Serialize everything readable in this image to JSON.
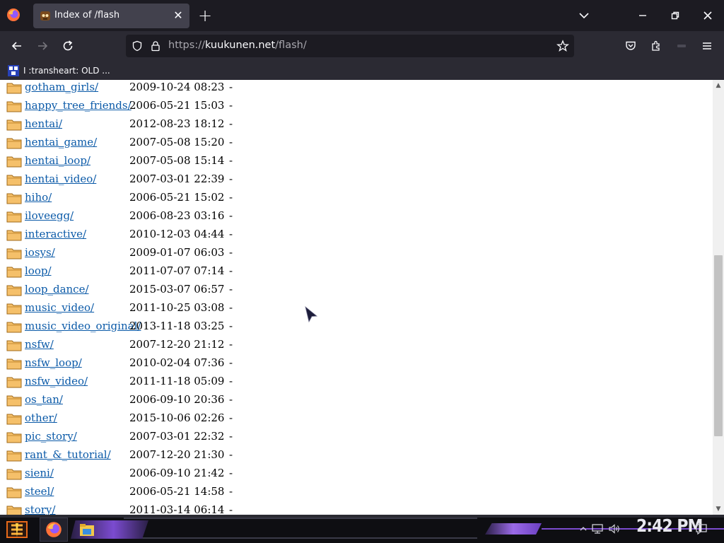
{
  "browser": {
    "tab_title": "Index of /flash",
    "url_prefix": "https://",
    "url_domain": "kuukunen.net",
    "url_path": "/flash/",
    "bookmark_label": "I :transheart: OLD ..."
  },
  "listing": {
    "entries": [
      {
        "name": "gotham_girls/",
        "date": "2009-10-24 08:23",
        "size": "-"
      },
      {
        "name": "happy_tree_friends/",
        "date": "2006-05-21 15:03",
        "size": "-"
      },
      {
        "name": "hentai/",
        "date": "2012-08-23 18:12",
        "size": "-"
      },
      {
        "name": "hentai_game/",
        "date": "2007-05-08 15:20",
        "size": "-"
      },
      {
        "name": "hentai_loop/",
        "date": "2007-05-08 15:14",
        "size": "-"
      },
      {
        "name": "hentai_video/",
        "date": "2007-03-01 22:39",
        "size": "-"
      },
      {
        "name": "hiho/",
        "date": "2006-05-21 15:02",
        "size": "-"
      },
      {
        "name": "iloveegg/",
        "date": "2006-08-23 03:16",
        "size": "-"
      },
      {
        "name": "interactive/",
        "date": "2010-12-03 04:44",
        "size": "-"
      },
      {
        "name": "iosys/",
        "date": "2009-01-07 06:03",
        "size": "-"
      },
      {
        "name": "loop/",
        "date": "2011-07-07 07:14",
        "size": "-"
      },
      {
        "name": "loop_dance/",
        "date": "2015-03-07 06:57",
        "size": "-"
      },
      {
        "name": "music_video/",
        "date": "2011-10-25 03:08",
        "size": "-"
      },
      {
        "name": "music_video_original/",
        "date": "2013-11-18 03:25",
        "size": "-"
      },
      {
        "name": "nsfw/",
        "date": "2007-12-20 21:12",
        "size": "-"
      },
      {
        "name": "nsfw_loop/",
        "date": "2010-02-04 07:36",
        "size": "-"
      },
      {
        "name": "nsfw_video/",
        "date": "2011-11-18 05:09",
        "size": "-"
      },
      {
        "name": "os_tan/",
        "date": "2006-09-10 20:36",
        "size": "-"
      },
      {
        "name": "other/",
        "date": "2015-10-06 02:26",
        "size": "-"
      },
      {
        "name": "pic_story/",
        "date": "2007-03-01 22:32",
        "size": "-"
      },
      {
        "name": "rant_&_tutorial/",
        "date": "2007-12-20 21:30",
        "size": "-"
      },
      {
        "name": "sieni/",
        "date": "2006-09-10 21:42",
        "size": "-"
      },
      {
        "name": "steel/",
        "date": "2006-05-21 14:58",
        "size": "-"
      },
      {
        "name": "story/",
        "date": "2011-03-14 06:14",
        "size": "-"
      }
    ]
  },
  "taskbar": {
    "clock": "2:42 PM"
  },
  "colors": {
    "link": "#0b5aa8",
    "folder_fill": "#f5c06a",
    "accent_purple": "#7b4bd0"
  },
  "icons": [
    "firefox-icon",
    "folder-icon",
    "shield-icon",
    "lock-icon",
    "star-icon",
    "pocket-icon",
    "extensions-icon",
    "menu-icon"
  ]
}
